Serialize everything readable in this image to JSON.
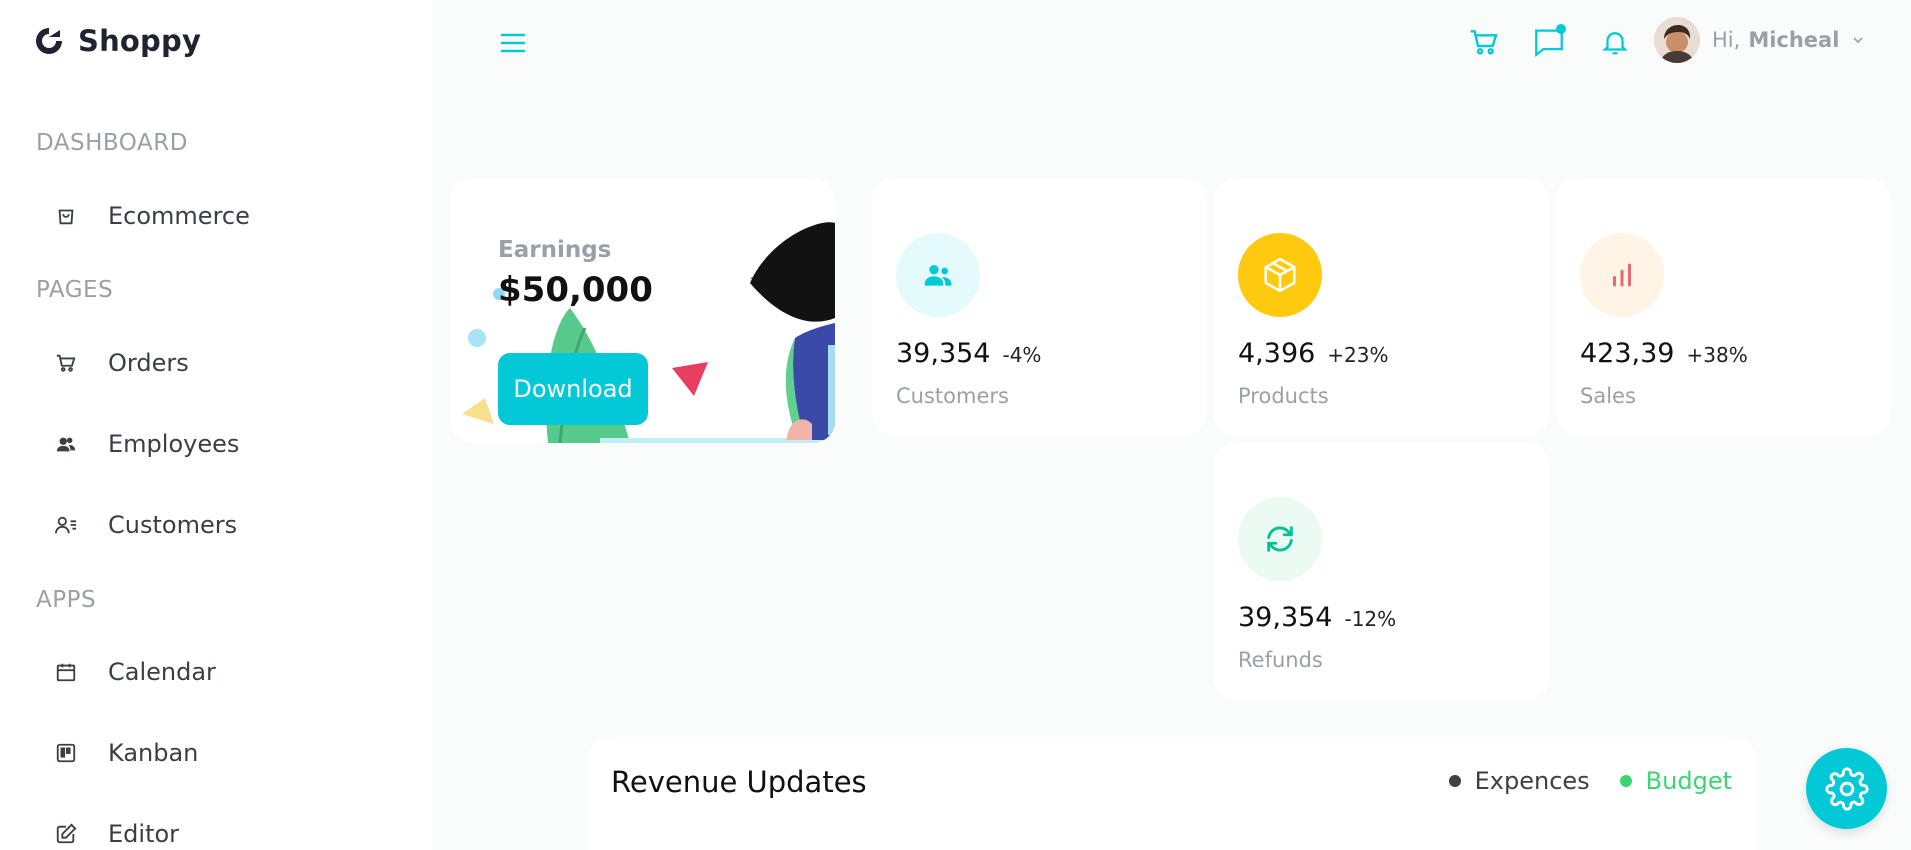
{
  "brand": {
    "name": "Shoppy"
  },
  "sidebar": {
    "sections": [
      {
        "title": "DASHBOARD",
        "items": [
          {
            "label": "Ecommerce",
            "icon": "shopping-bag-icon"
          }
        ]
      },
      {
        "title": "PAGES",
        "items": [
          {
            "label": "Orders",
            "icon": "cart-icon"
          },
          {
            "label": "Employees",
            "icon": "employees-icon"
          },
          {
            "label": "Customers",
            "icon": "customers-icon"
          }
        ]
      },
      {
        "title": "APPS",
        "items": [
          {
            "label": "Calendar",
            "icon": "calendar-icon"
          },
          {
            "label": "Kanban",
            "icon": "kanban-icon"
          },
          {
            "label": "Editor",
            "icon": "editor-icon"
          }
        ]
      }
    ]
  },
  "header": {
    "greeting": "Hi,",
    "user_name": "Micheal",
    "icons": [
      "menu-icon",
      "cart-icon",
      "chat-icon",
      "bell-icon",
      "chevron-down-icon"
    ]
  },
  "earnings": {
    "label": "Earnings",
    "value": "$50,000",
    "download_label": "Download"
  },
  "stats": [
    {
      "amount": "39,354",
      "percentage": "-4%",
      "title": "Customers",
      "icon": "users-icon",
      "icon_color": "#03c9d7",
      "icon_bg": "#e5fafb"
    },
    {
      "amount": "4,396",
      "percentage": "+23%",
      "title": "Products",
      "icon": "box-icon",
      "icon_color": "#ffffff",
      "icon_bg": "#fec90f"
    },
    {
      "amount": "423,39",
      "percentage": "+38%",
      "title": "Sales",
      "icon": "bar-chart-icon",
      "icon_color": "#e46a76",
      "icon_bg": "#fff4e5"
    },
    {
      "amount": "39,354",
      "percentage": "-12%",
      "title": "Refunds",
      "icon": "refresh-icon",
      "icon_color": "#00c292",
      "icon_bg": "#ebfaf2"
    }
  ],
  "revenue": {
    "title": "Revenue Updates",
    "legend": [
      {
        "label": "Expences",
        "color": "#404041"
      },
      {
        "label": "Budget",
        "color": "#00bdae"
      }
    ]
  },
  "colors": {
    "accent": "#03c9d7",
    "budget_green": "#3bd671"
  }
}
